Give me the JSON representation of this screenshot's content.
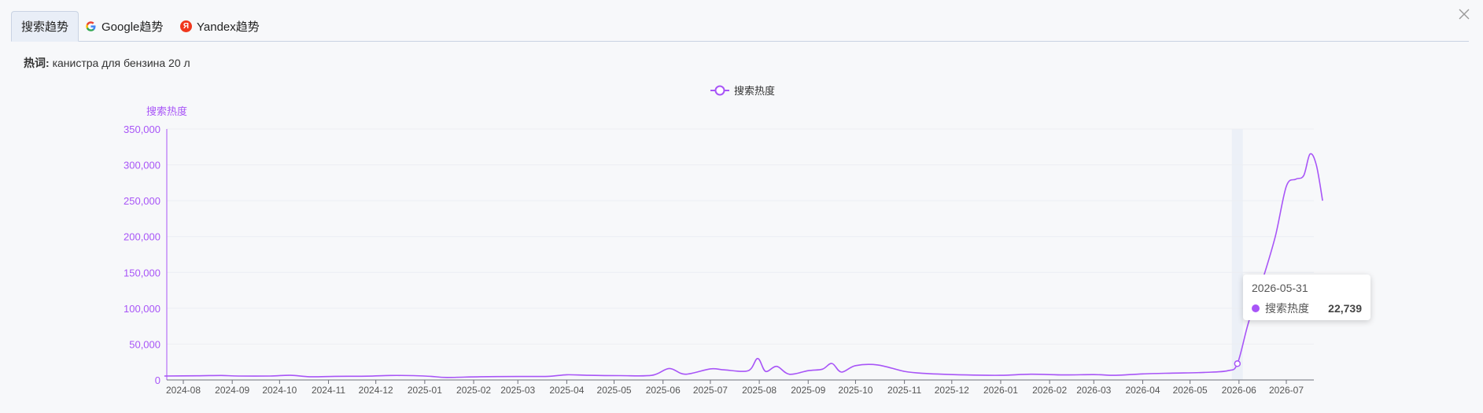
{
  "tabs": [
    {
      "label": "搜索趋势",
      "icon": "none"
    },
    {
      "label": "Google趋势",
      "icon": "google-icon"
    },
    {
      "label": "Yandex趋势",
      "icon": "yandex-icon"
    }
  ],
  "keyword": {
    "label": "热词:",
    "value": "канистра для бензина 20 л"
  },
  "chart_data": {
    "type": "line",
    "legend": "搜索热度",
    "legend_position": "top-center",
    "ylabel": "搜索热度",
    "ylim": [
      0,
      350000
    ],
    "yticks": [
      "0",
      "50,000",
      "100,000",
      "150,000",
      "200,000",
      "250,000",
      "300,000",
      "350,000"
    ],
    "xticks": [
      "2024-08",
      "2024-09",
      "2024-10",
      "2024-11",
      "2024-12",
      "2025-01",
      "2025-02",
      "2025-03",
      "2025-04",
      "2025-05",
      "2025-06",
      "2025-07",
      "2025-08",
      "2025-09",
      "2025-10",
      "2025-11",
      "2025-12",
      "2026-01",
      "2026-02",
      "2026-03",
      "2026-04",
      "2026-05",
      "2026-06",
      "2026-07"
    ],
    "grid": true,
    "color": "#a855f7",
    "series": [
      {
        "name": "搜索热度",
        "points": [
          [
            "2024-07-20",
            5500
          ],
          [
            "2024-08-10",
            5800
          ],
          [
            "2024-08-25",
            6200
          ],
          [
            "2024-09-05",
            5500
          ],
          [
            "2024-09-25",
            5500
          ],
          [
            "2024-10-08",
            6500
          ],
          [
            "2024-10-20",
            4500
          ],
          [
            "2024-11-05",
            5000
          ],
          [
            "2024-11-25",
            5300
          ],
          [
            "2024-12-10",
            6200
          ],
          [
            "2024-12-25",
            6000
          ],
          [
            "2025-01-05",
            5000
          ],
          [
            "2025-01-15",
            3500
          ],
          [
            "2025-02-05",
            4500
          ],
          [
            "2025-03-01",
            4800
          ],
          [
            "2025-03-20",
            5000
          ],
          [
            "2025-04-01",
            7200
          ],
          [
            "2025-04-15",
            6500
          ],
          [
            "2025-05-05",
            6000
          ],
          [
            "2025-05-25",
            6500
          ],
          [
            "2025-06-05",
            16000
          ],
          [
            "2025-06-15",
            8000
          ],
          [
            "2025-07-01",
            15500
          ],
          [
            "2025-07-10",
            14000
          ],
          [
            "2025-07-25",
            13000
          ],
          [
            "2025-07-31",
            30000
          ],
          [
            "2025-08-05",
            12000
          ],
          [
            "2025-08-12",
            19000
          ],
          [
            "2025-08-20",
            8000
          ],
          [
            "2025-09-01",
            13000
          ],
          [
            "2025-09-10",
            15000
          ],
          [
            "2025-09-16",
            23000
          ],
          [
            "2025-09-22",
            11000
          ],
          [
            "2025-10-01",
            20000
          ],
          [
            "2025-10-15",
            21000
          ],
          [
            "2025-11-01",
            12000
          ],
          [
            "2025-11-15",
            9000
          ],
          [
            "2025-12-10",
            7000
          ],
          [
            "2026-01-01",
            6500
          ],
          [
            "2026-01-20",
            8000
          ],
          [
            "2026-02-10",
            7000
          ],
          [
            "2026-03-01",
            7500
          ],
          [
            "2026-03-15",
            6500
          ],
          [
            "2026-04-01",
            8500
          ],
          [
            "2026-04-20",
            9500
          ],
          [
            "2026-05-10",
            10500
          ],
          [
            "2026-05-25",
            13000
          ],
          [
            "2026-05-31",
            22739
          ],
          [
            "2026-06-07",
            80000
          ],
          [
            "2026-06-16",
            140000
          ],
          [
            "2026-06-24",
            200000
          ],
          [
            "2026-07-01",
            270000
          ],
          [
            "2026-07-07",
            280000
          ],
          [
            "2026-07-12",
            285000
          ],
          [
            "2026-07-16",
            315000
          ],
          [
            "2026-07-20",
            300000
          ],
          [
            "2026-07-24",
            250000
          ]
        ]
      }
    ],
    "tooltip": {
      "date": "2026-05-31",
      "series": "搜索热度",
      "value": "22,739"
    }
  }
}
